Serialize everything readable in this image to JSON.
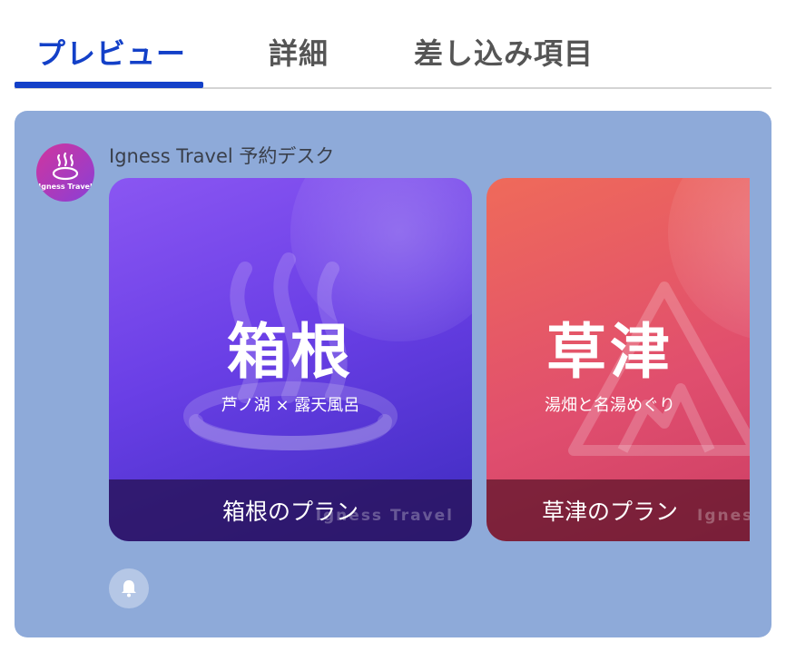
{
  "tabs": [
    {
      "label": "プレビュー",
      "active": true
    },
    {
      "label": "詳細",
      "active": false
    },
    {
      "label": "差し込み項目",
      "active": false
    }
  ],
  "message": {
    "sender": "Igness Travel 予約デスク",
    "avatar_text": "Igness Travel",
    "avatar_icon": "hot-spring-icon"
  },
  "cards": [
    {
      "title": "箱根",
      "subtitle": "芦ノ湖 × 露天風呂",
      "label": "箱根のプラン",
      "watermark": "Igness Travel",
      "art_icon": "hot-spring-icon"
    },
    {
      "title": "草津",
      "subtitle": "湯畑と名湯めぐり",
      "label": "草津のプラン",
      "watermark": "Igness",
      "art_icon": "mountain-icon"
    }
  ],
  "notification": {
    "icon": "bell-icon"
  },
  "colors": {
    "accent": "#1340c8",
    "panel": "#8eaad9",
    "card_hakone": "#6a3fe6",
    "card_kusatsu": "#e04e6e"
  }
}
